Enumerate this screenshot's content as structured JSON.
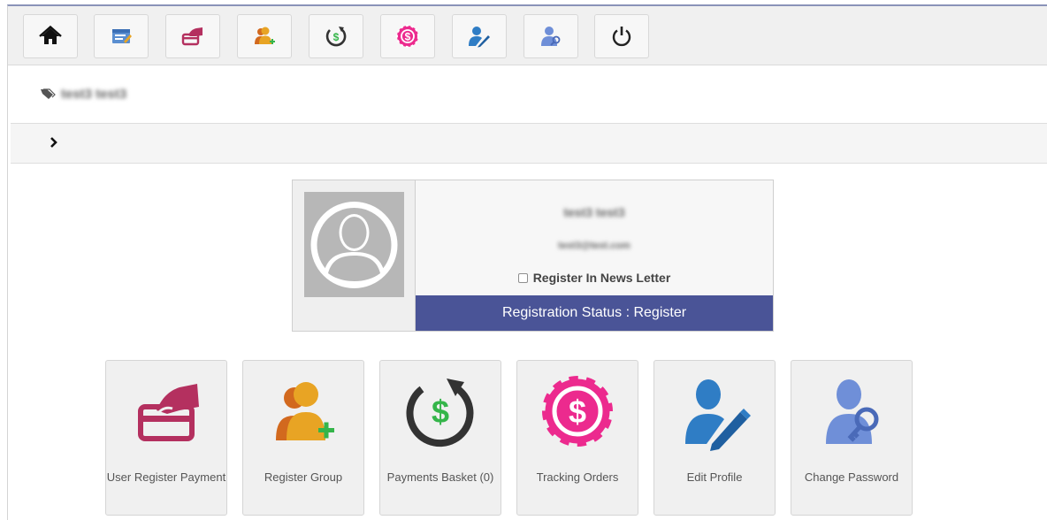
{
  "toolbar": {
    "buttons": [
      {
        "icon": "home-icon"
      },
      {
        "icon": "form-icon"
      },
      {
        "icon": "card-payment-icon"
      },
      {
        "icon": "user-group-icon"
      },
      {
        "icon": "payment-refresh-icon"
      },
      {
        "icon": "dollar-chip-icon"
      },
      {
        "icon": "edit-user-icon"
      },
      {
        "icon": "user-key-icon"
      },
      {
        "icon": "power-icon"
      }
    ]
  },
  "header": {
    "username": "test3 test3"
  },
  "profile": {
    "name": "test3 test3",
    "email": "test3@test.com",
    "newsletter_label": "Register In News Letter",
    "newsletter_checked": false,
    "status": "Registration Status : Register"
  },
  "tiles": [
    {
      "icon": "card-payment-icon",
      "label": "User Register Payment"
    },
    {
      "icon": "user-group-icon",
      "label": "Register Group"
    },
    {
      "icon": "payment-refresh-icon",
      "label": "Payments Basket (0)"
    },
    {
      "icon": "dollar-chip-icon",
      "label": "Tracking Orders"
    },
    {
      "icon": "edit-user-icon",
      "label": "Edit Profile"
    },
    {
      "icon": "user-key-icon",
      "label": "Change Password"
    }
  ],
  "colors": {
    "status_bar": "#4a5497",
    "card_pink": "#b4305f",
    "orange": "#e8a424",
    "green": "#35b54a",
    "magenta": "#ec2a8e",
    "blue": "#2f7dc5",
    "light_blue": "#6f8fd8"
  }
}
